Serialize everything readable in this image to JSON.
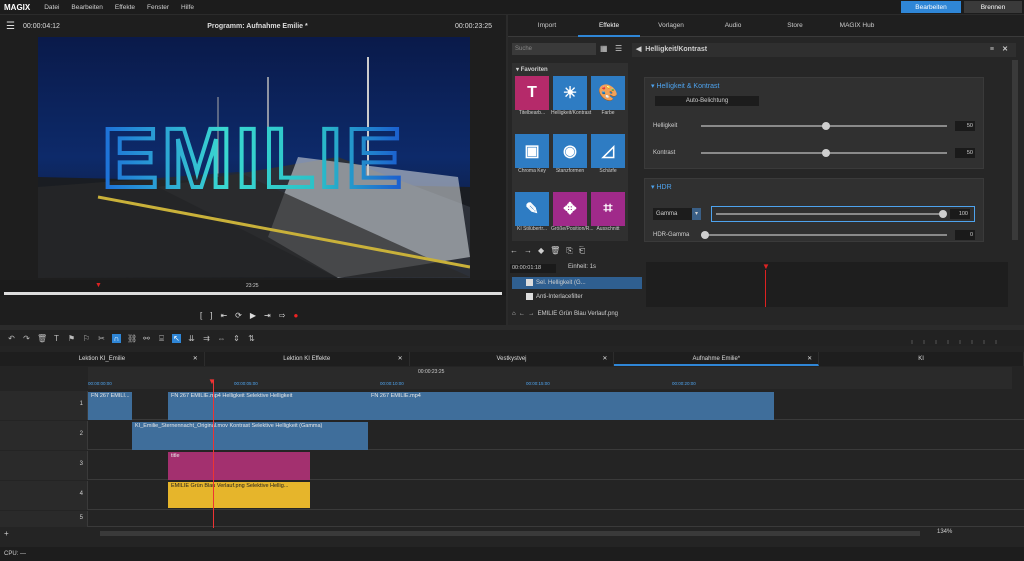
{
  "app": {
    "logo": "MAGIX"
  },
  "menu": [
    "Datei",
    "Bearbeiten",
    "Effekte",
    "Fenster",
    "Hilfe"
  ],
  "modes": {
    "edit": "Bearbeiten",
    "burn": "Brennen",
    "accent": "#2f86d6"
  },
  "player": {
    "time_left": "00:00:04:12",
    "title": "Programm: Aufnahme Emilie *",
    "time_right": "00:00:23:25",
    "overlay_text": "EMILIE",
    "scrub_time": "23:25",
    "controls": [
      "[",
      "]"
    ]
  },
  "right_tabs": [
    "Import",
    "Effekte",
    "Vorlagen",
    "Audio",
    "Store",
    "MAGIX Hub"
  ],
  "effects": {
    "search_placeholder": "Suche",
    "category": "Favoriten",
    "tiles": [
      {
        "label": "Titelbearb...",
        "icon": "T",
        "color": "#b52a6a"
      },
      {
        "label": "Helligkeit/Kontrast",
        "icon": "☀",
        "color": "#2e7cc3"
      },
      {
        "label": "Farbe",
        "icon": "🎨",
        "color": "#2e7cc3"
      },
      {
        "label": "Chroma Key",
        "icon": "▣",
        "color": "#2e7cc3"
      },
      {
        "label": "Stanzformen",
        "icon": "◉",
        "color": "#2e7cc3"
      },
      {
        "label": "Schärfe",
        "icon": "◿",
        "color": "#2e7cc3"
      },
      {
        "label": "KI Stilübertr...",
        "icon": "✎",
        "color": "#2e7cc3"
      },
      {
        "label": "Größe/Position/R...",
        "icon": "✥",
        "color": "#a02a8a"
      },
      {
        "label": "Ausschnitt",
        "icon": "⌗",
        "color": "#a02a8a"
      }
    ]
  },
  "props": {
    "title": "Helligkeit/Kontrast",
    "section1": "Helligkeit & Kontrast",
    "auto_btn": "Auto-Belichtung",
    "brightness_label": "Helligkeit",
    "brightness_value": "50",
    "contrast_label": "Kontrast",
    "contrast_value": "50",
    "section2": "HDR",
    "gamma_select": "Gamma",
    "gamma_value": "100",
    "hdr_gamma_label": "HDR-Gamma",
    "hdr_gamma_value": "0"
  },
  "keyframes": {
    "time": "00:00:01:18",
    "unit_label": "Einheit:",
    "unit_value": "1s",
    "rows": [
      "Sel. Helligkeit (G...",
      "Anti-Interlacefilter"
    ],
    "file": "EMILIE Grün Blau Verlauf.png"
  },
  "project_tabs": [
    "Lektion KI_Emilie",
    "Lektion KI Effekte",
    "Vestkystvej",
    "Aufnahme Emilie*",
    "KI"
  ],
  "timeline": {
    "cursor_time": "00:00:23:25",
    "ruler": [
      "00:00:00:00",
      "00:00:05:00",
      "00:00:10:00",
      "00:00:15:00",
      "00:00:20:00"
    ],
    "tracks": [
      "1",
      "2",
      "3",
      "4",
      "5"
    ],
    "clips": [
      {
        "label": "FN 267 EMILI...",
        "track": 0
      },
      {
        "label": "FN 267 EMILIE.mp4   Helligkeit   Selektive Helligkeit",
        "track": 0
      },
      {
        "label": "FN 267 EMILIE.mp4",
        "track": 0
      },
      {
        "label": "KI_Emilie_Sternennacht_Original.mov   Kontrast   Selektive Helligkeit (Gamma)",
        "track": 1
      },
      {
        "label": "title",
        "track": 2
      },
      {
        "label": "EMILIE Grün Blau Verlauf.png   Selektive Hellig...",
        "track": 3
      }
    ],
    "zoom": "134%"
  },
  "status": {
    "cpu": "CPU: —"
  }
}
